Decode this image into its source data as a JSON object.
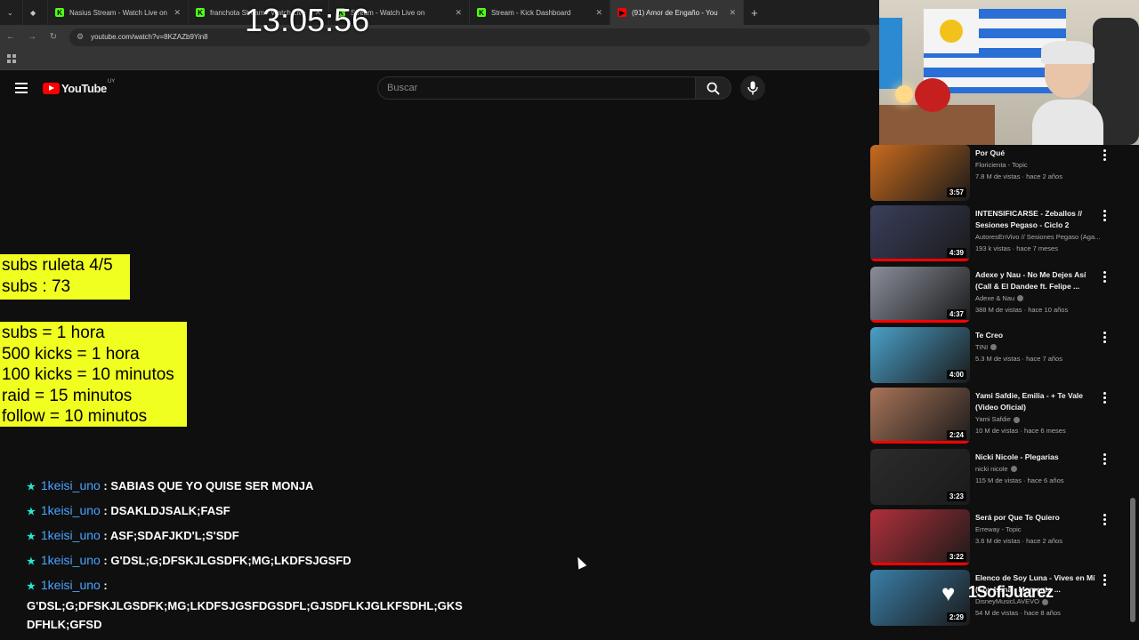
{
  "browser": {
    "tabs": [
      {
        "title": "Nasius Stream - Watch Live on",
        "color": "#53fc18",
        "letter": "K"
      },
      {
        "title": "franchota Stream - Watch Live",
        "color": "#53fc18",
        "letter": "K"
      },
      {
        "title": "Stream - Watch Live on",
        "color": "#53fc18",
        "letter": "K"
      },
      {
        "title": "Stream - Kick Dashboard",
        "color": "#53fc18",
        "letter": "K"
      },
      {
        "title": "(91) Amor de Engaño - You",
        "color": "#ff0000",
        "letter": "▶"
      }
    ],
    "new_tab_label": "+",
    "url": "youtube.com/watch?v=8KZAZb9Yin8"
  },
  "overlay": {
    "clock": "13:05:56",
    "subs_box": [
      "subs ruleta 4/5",
      "subs : 73"
    ],
    "rules_box": [
      "subs = 1 hora",
      "500 kicks = 1 hora",
      "100 kicks = 10 minutos",
      "raid = 15 minutos",
      "follow = 10 minutos"
    ],
    "streamer_name": "1SofiJuarez"
  },
  "youtube": {
    "logo_text": "YouTube",
    "country_code": "UY",
    "search_placeholder": "Buscar"
  },
  "chat": [
    {
      "user": "1keisi_uno",
      "sep": " : ",
      "text": "SABIAS QUE YO QUISE SER MONJA"
    },
    {
      "user": "1keisi_uno",
      "sep": " : ",
      "text": "DSAKLDJSALK;FASF"
    },
    {
      "user": "1keisi_uno",
      "sep": " : ",
      "text": "ASF;SDAFJKD'L;S'SDF"
    },
    {
      "user": "1keisi_uno",
      "sep": " : ",
      "text": "G'DSL;G;DFSKJLGSDFK;MG;LKDFSJGSFD"
    },
    {
      "user": "1keisi_uno",
      "sep": " :",
      "text": "G'DSL;G;DFSKJLGSDFK;MG;LKDFSJGSFDGSDFL;GJSDFLKJGLKFSDHL;GKS DFHLK;GFSD"
    }
  ],
  "related": [
    {
      "title": "Por Qué",
      "channel": "Floricienta - Topic",
      "meta": "7.8 M de vistas · hace 2 años",
      "duration": "3:57",
      "thumb": "#c96b1e",
      "verified": false,
      "progress": 0
    },
    {
      "title": "INTENSIFICARSE - Zeballos // Sesiones Pegaso - Ciclo 2",
      "channel": "AutoresEnVivo // Sesiones Pegaso (Aga...",
      "meta": "193 k vistas · hace 7 meses",
      "duration": "4:39",
      "thumb": "#3a3f5c",
      "verified": false,
      "progress": 1
    },
    {
      "title": "Adexe y Nau - No Me Dejes Así (Call & El Dandee ft. Felipe ...",
      "channel": "Adexe & Nau",
      "meta": "388 M de vistas · hace 10 años",
      "duration": "4:37",
      "thumb": "#8a8e9a",
      "verified": true,
      "progress": 1
    },
    {
      "title": "Te Creo",
      "channel": "TINI",
      "meta": "5.3 M de vistas · hace 7 años",
      "duration": "4:00",
      "thumb": "#4aa0c8",
      "verified": true,
      "progress": 0
    },
    {
      "title": "Yami Safdie, Emilia - + Te Vale (Video Oficial)",
      "channel": "Yami Safdie",
      "meta": "10 M de vistas · hace 6 meses",
      "duration": "2:24",
      "thumb": "#a87458",
      "verified": true,
      "progress": 1
    },
    {
      "title": "Nicki Nicole - Plegarias",
      "channel": "nicki nicole",
      "meta": "115 M de vistas · hace 6 años",
      "duration": "3:23",
      "thumb": "#2c2c2c",
      "verified": true,
      "progress": 0
    },
    {
      "title": "Será por Que Te Quiero",
      "channel": "Erreway - Topic",
      "meta": "3.6 M de vistas · hace 2 años",
      "duration": "3:22",
      "thumb": "#b0303a",
      "verified": false,
      "progress": 1
    },
    {
      "title": "Elenco de Soy Luna - Vives en Mí (Soy Luna - Momento ...",
      "channel": "DisneyMusicLAVEVO",
      "meta": "54 M de vistas · hace 8 años",
      "duration": "2:29",
      "thumb": "#3a7fa8",
      "verified": true,
      "progress": 0
    }
  ]
}
